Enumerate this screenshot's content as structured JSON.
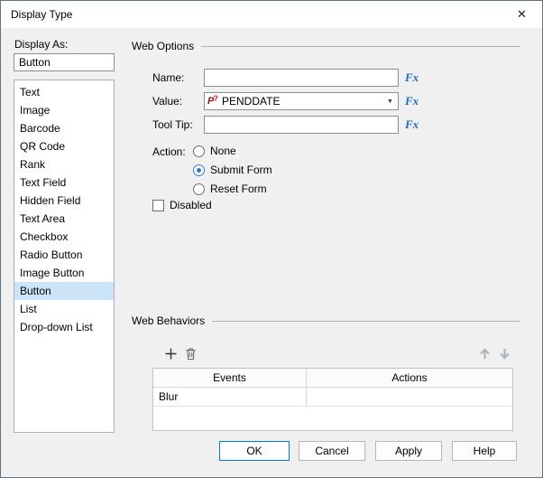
{
  "dialog": {
    "title": "Display Type"
  },
  "icons": {
    "close": "✕",
    "dropdown_arrow": "▼",
    "param_letter": "P",
    "param_mark": "?"
  },
  "left_panel": {
    "label": "Display As:",
    "current_value": "Button",
    "items": [
      "Text",
      "Image",
      "Barcode",
      "QR Code",
      "Rank",
      "Text Field",
      "Hidden Field",
      "Text Area",
      "Checkbox",
      "Radio Button",
      "Image Button",
      "Button",
      "List",
      "Drop-down List"
    ],
    "selected_item": "Button"
  },
  "web_options": {
    "group_label": "Web Options",
    "fx_label": "Fx",
    "name_label": "Name:",
    "name_value": "",
    "value_label": "Value:",
    "value_selected": "PENDDATE",
    "tooltip_label": "Tool Tip:",
    "tooltip_value": "",
    "action_label": "Action:",
    "actions": [
      "None",
      "Submit Form",
      "Reset Form"
    ],
    "action_selected": "Submit Form",
    "disabled_label": "Disabled",
    "disabled_checked": false
  },
  "web_behaviors": {
    "group_label": "Web Behaviors",
    "table": {
      "headers": [
        "Events",
        "Actions"
      ],
      "rows": [
        [
          "Blur",
          ""
        ]
      ]
    }
  },
  "footer": {
    "ok": "OK",
    "cancel": "Cancel",
    "apply": "Apply",
    "help": "Help"
  }
}
